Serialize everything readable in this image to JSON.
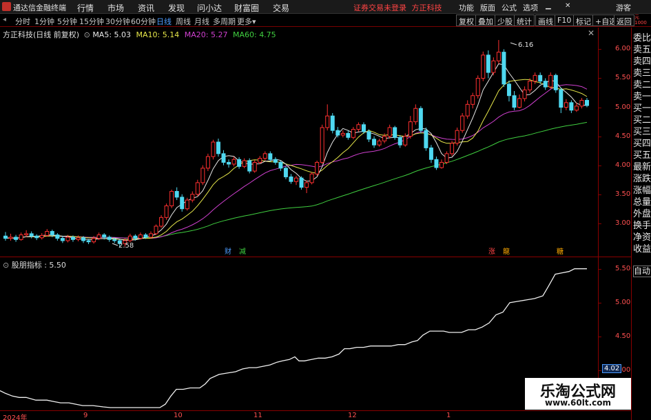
{
  "app": {
    "title": "通达信金融终端",
    "menu": [
      "行情",
      "市场",
      "资讯",
      "发现",
      "问小达",
      "财富圈",
      "交易"
    ],
    "notice": "证券交易未登录",
    "stock_name_top": "方正科技",
    "right_menu": [
      "功能",
      "版面",
      "公式",
      "选项"
    ],
    "guest": "游客"
  },
  "periods": [
    "分时",
    "1分钟",
    "5分钟",
    "15分钟",
    "30分钟",
    "60分钟",
    "日线",
    "周线",
    "月线",
    "多周期",
    "更多"
  ],
  "active_period": "日线",
  "tools": [
    "复权",
    "叠加",
    "少股",
    "统计",
    "画线",
    "F10",
    "标记",
    "+自选",
    "返回"
  ],
  "main": {
    "label": "方正科技(日线 前复权)",
    "ma": [
      {
        "name": "MA5",
        "value": "5.03",
        "color": "#e8e8e8"
      },
      {
        "name": "MA10",
        "value": "5.14",
        "color": "#e8e84a"
      },
      {
        "name": "MA20",
        "value": "5.27",
        "color": "#d040d0"
      },
      {
        "name": "MA60",
        "value": "4.75",
        "color": "#40d040"
      }
    ],
    "high_label": "6.16",
    "low_label": "2.58",
    "markers": [
      {
        "text": "财",
        "color": "#4d9cff"
      },
      {
        "text": "减",
        "color": "#40d040"
      },
      {
        "text": "涨",
        "color": "#ff4444"
      },
      {
        "text": "龍",
        "color": "#ffaa00"
      },
      {
        "text": "糖",
        "color": "#ffaa00"
      }
    ]
  },
  "side_panel": [
    "委比",
    "卖五",
    "卖四",
    "卖三",
    "卖二",
    "卖一",
    "买一",
    "买二",
    "买三",
    "买四",
    "买五",
    "最新",
    "涨跌",
    "涨幅",
    "总量",
    "外盘",
    "换手",
    "净资",
    "收益",
    "自动"
  ],
  "indicator": {
    "label": "股朋指标",
    "value": "5.50",
    "current_tag": "4.02"
  },
  "time_axis": [
    "2024年",
    "9",
    "10",
    "11",
    "12",
    "1"
  ],
  "watermark": {
    "title": "乐淘公式网",
    "url": "www.60lt.com"
  },
  "chart_data": [
    {
      "type": "candlestick",
      "title": "",
      "y_ticks": [
        6.0,
        5.5,
        5.0,
        4.5,
        4.0,
        3.5,
        3.0
      ],
      "ylim": [
        2.45,
        6.35
      ],
      "colors": {
        "up": "#ff3030",
        "down": "#4fd8f0"
      },
      "grid": false,
      "candles": [
        [
          2.78,
          2.74,
          2.85,
          2.7
        ],
        [
          2.74,
          2.76,
          2.82,
          2.7
        ],
        [
          2.76,
          2.72,
          2.8,
          2.68
        ],
        [
          2.72,
          2.8,
          2.84,
          2.7
        ],
        [
          2.8,
          2.82,
          2.88,
          2.76
        ],
        [
          2.82,
          2.78,
          2.86,
          2.74
        ],
        [
          2.78,
          2.75,
          2.81,
          2.71
        ],
        [
          2.75,
          2.79,
          2.83,
          2.72
        ],
        [
          2.79,
          2.86,
          2.9,
          2.77
        ],
        [
          2.86,
          2.8,
          2.89,
          2.76
        ],
        [
          2.8,
          2.74,
          2.83,
          2.7
        ],
        [
          2.74,
          2.7,
          2.78,
          2.66
        ],
        [
          2.7,
          2.76,
          2.8,
          2.67
        ],
        [
          2.76,
          2.72,
          2.79,
          2.68
        ],
        [
          2.72,
          2.75,
          2.79,
          2.69
        ],
        [
          2.75,
          2.7,
          2.78,
          2.66
        ],
        [
          2.7,
          2.68,
          2.73,
          2.64
        ],
        [
          2.68,
          2.74,
          2.78,
          2.65
        ],
        [
          2.74,
          2.8,
          2.84,
          2.71
        ],
        [
          2.8,
          2.76,
          2.83,
          2.72
        ],
        [
          2.76,
          2.72,
          2.79,
          2.68
        ],
        [
          2.72,
          2.7,
          2.75,
          2.66
        ],
        [
          2.7,
          2.65,
          2.72,
          2.58
        ],
        [
          2.65,
          2.7,
          2.74,
          2.6
        ],
        [
          2.7,
          2.78,
          2.82,
          2.67
        ],
        [
          2.78,
          2.74,
          2.81,
          2.7
        ],
        [
          2.74,
          2.8,
          2.84,
          2.72
        ],
        [
          2.8,
          2.76,
          2.83,
          2.73
        ],
        [
          2.76,
          2.82,
          2.86,
          2.74
        ],
        [
          2.82,
          2.95,
          2.98,
          2.8
        ],
        [
          2.95,
          3.1,
          3.14,
          2.92
        ],
        [
          3.1,
          3.3,
          3.34,
          3.06
        ],
        [
          3.3,
          3.55,
          3.58,
          3.26
        ],
        [
          3.55,
          3.45,
          3.62,
          3.4
        ],
        [
          3.45,
          3.25,
          3.5,
          3.2
        ],
        [
          3.25,
          3.4,
          3.44,
          3.22
        ],
        [
          3.4,
          3.5,
          3.55,
          3.36
        ],
        [
          3.5,
          3.7,
          3.75,
          3.46
        ],
        [
          3.7,
          3.95,
          4.0,
          3.66
        ],
        [
          3.95,
          4.15,
          4.2,
          3.9
        ],
        [
          4.15,
          4.4,
          4.44,
          4.1
        ],
        [
          4.4,
          4.2,
          4.46,
          4.15
        ],
        [
          4.2,
          4.05,
          4.26,
          4.0
        ],
        [
          4.05,
          4.02,
          4.1,
          3.96
        ],
        [
          4.02,
          4.1,
          4.15,
          3.98
        ],
        [
          4.1,
          3.98,
          4.14,
          3.94
        ],
        [
          3.98,
          4.08,
          4.12,
          3.95
        ],
        [
          4.08,
          3.9,
          4.12,
          3.86
        ],
        [
          3.9,
          4.05,
          4.09,
          3.87
        ],
        [
          4.05,
          4.12,
          4.16,
          4.02
        ],
        [
          4.12,
          4.2,
          4.24,
          4.08
        ],
        [
          4.2,
          4.1,
          4.24,
          4.06
        ],
        [
          4.1,
          4.05,
          4.14,
          4.01
        ],
        [
          4.05,
          3.95,
          4.08,
          3.9
        ],
        [
          3.95,
          3.8,
          3.98,
          3.76
        ],
        [
          3.8,
          3.72,
          3.85,
          3.68
        ],
        [
          3.72,
          3.78,
          3.82,
          3.66
        ],
        [
          3.78,
          3.62,
          3.81,
          3.58
        ],
        [
          3.62,
          3.7,
          3.74,
          3.52
        ],
        [
          3.7,
          3.85,
          3.88,
          3.67
        ],
        [
          3.85,
          4.05,
          4.08,
          3.82
        ],
        [
          4.05,
          4.65,
          4.7,
          4.02
        ],
        [
          4.65,
          4.85,
          5.05,
          4.6
        ],
        [
          4.85,
          4.6,
          4.9,
          4.55
        ],
        [
          4.6,
          4.52,
          4.66,
          4.48
        ],
        [
          4.52,
          4.55,
          4.6,
          4.48
        ],
        [
          4.55,
          4.48,
          4.6,
          4.44
        ],
        [
          4.48,
          4.62,
          4.66,
          4.45
        ],
        [
          4.62,
          4.7,
          4.74,
          4.58
        ],
        [
          4.7,
          4.58,
          4.74,
          4.54
        ],
        [
          4.58,
          4.45,
          4.62,
          4.4
        ],
        [
          4.45,
          4.35,
          4.5,
          4.3
        ],
        [
          4.35,
          4.42,
          4.46,
          4.32
        ],
        [
          4.42,
          4.5,
          4.55,
          4.38
        ],
        [
          4.5,
          4.65,
          4.7,
          4.46
        ],
        [
          4.65,
          4.48,
          4.68,
          4.44
        ],
        [
          4.48,
          4.35,
          4.52,
          4.3
        ],
        [
          4.35,
          4.5,
          4.55,
          4.32
        ],
        [
          4.5,
          4.75,
          4.85,
          4.46
        ],
        [
          4.75,
          4.98,
          5.05,
          4.7
        ],
        [
          4.98,
          4.6,
          5.02,
          4.55
        ],
        [
          4.6,
          4.3,
          4.65,
          4.25
        ],
        [
          4.3,
          4.1,
          4.35,
          4.04
        ],
        [
          4.1,
          3.96,
          4.15,
          3.92
        ],
        [
          3.96,
          4.05,
          4.1,
          3.94
        ],
        [
          4.05,
          4.2,
          4.24,
          4.02
        ],
        [
          4.2,
          4.38,
          4.42,
          4.16
        ],
        [
          4.38,
          4.6,
          4.65,
          4.34
        ],
        [
          4.6,
          4.85,
          4.9,
          4.56
        ],
        [
          4.85,
          5.05,
          5.12,
          4.8
        ],
        [
          5.05,
          5.2,
          5.25,
          4.98
        ],
        [
          5.2,
          5.5,
          5.55,
          5.15
        ],
        [
          5.5,
          5.9,
          5.96,
          5.45
        ],
        [
          5.9,
          5.6,
          5.98,
          5.5
        ],
        [
          5.6,
          5.8,
          5.86,
          5.55
        ],
        [
          5.8,
          5.95,
          6.16,
          5.75
        ],
        [
          5.95,
          5.4,
          6.0,
          5.35
        ],
        [
          5.4,
          5.2,
          5.46,
          5.1
        ],
        [
          5.2,
          5.0,
          5.28,
          4.95
        ],
        [
          5.0,
          5.15,
          5.22,
          4.98
        ],
        [
          5.15,
          5.3,
          5.36,
          5.1
        ],
        [
          5.3,
          5.45,
          5.5,
          5.25
        ],
        [
          5.45,
          5.55,
          5.6,
          5.4
        ],
        [
          5.55,
          5.45,
          5.6,
          5.4
        ],
        [
          5.45,
          5.35,
          5.5,
          5.3
        ],
        [
          5.35,
          5.55,
          5.6,
          5.32
        ],
        [
          5.55,
          5.3,
          5.58,
          5.25
        ],
        [
          5.3,
          5.0,
          5.34,
          4.9
        ],
        [
          5.0,
          5.08,
          5.14,
          4.95
        ],
        [
          5.08,
          4.95,
          5.12,
          4.9
        ],
        [
          4.95,
          5.02,
          5.08,
          4.92
        ],
        [
          5.02,
          5.12,
          5.16,
          4.98
        ],
        [
          5.12,
          5.03,
          5.16,
          5.0
        ]
      ]
    },
    {
      "type": "line",
      "title": "",
      "series_name": "股朋指标",
      "y_ticks": [
        5.5,
        5.0,
        4.5,
        4.0,
        3.5
      ],
      "ylim": [
        3.45,
        5.65
      ],
      "points": [
        [
          0,
          3.7
        ],
        [
          8,
          3.66
        ],
        [
          18,
          3.62
        ],
        [
          28,
          3.6
        ],
        [
          38,
          3.6
        ],
        [
          52,
          3.56
        ],
        [
          68,
          3.56
        ],
        [
          78,
          3.54
        ],
        [
          88,
          3.52
        ],
        [
          100,
          3.52
        ],
        [
          110,
          3.5
        ],
        [
          120,
          3.48
        ],
        [
          135,
          3.48
        ],
        [
          150,
          3.46
        ],
        [
          160,
          3.45
        ],
        [
          172,
          3.45
        ],
        [
          185,
          3.45
        ],
        [
          198,
          3.45
        ],
        [
          210,
          3.45
        ],
        [
          222,
          3.45
        ],
        [
          232,
          3.45
        ],
        [
          240,
          3.5
        ],
        [
          248,
          3.62
        ],
        [
          256,
          3.72
        ],
        [
          266,
          3.72
        ],
        [
          276,
          3.74
        ],
        [
          290,
          3.74
        ],
        [
          298,
          3.8
        ],
        [
          305,
          3.88
        ],
        [
          318,
          3.94
        ],
        [
          330,
          3.96
        ],
        [
          342,
          3.98
        ],
        [
          352,
          4.02
        ],
        [
          362,
          4.04
        ],
        [
          372,
          4.04
        ],
        [
          382,
          4.06
        ],
        [
          392,
          4.08
        ],
        [
          402,
          4.12
        ],
        [
          410,
          4.14
        ],
        [
          420,
          4.16
        ],
        [
          428,
          4.2
        ],
        [
          434,
          4.14
        ],
        [
          442,
          4.14
        ],
        [
          452,
          4.16
        ],
        [
          462,
          4.18
        ],
        [
          472,
          4.18
        ],
        [
          482,
          4.2
        ],
        [
          492,
          4.24
        ],
        [
          500,
          4.32
        ],
        [
          508,
          4.32
        ],
        [
          518,
          4.34
        ],
        [
          528,
          4.34
        ],
        [
          538,
          4.36
        ],
        [
          548,
          4.36
        ],
        [
          558,
          4.36
        ],
        [
          568,
          4.36
        ],
        [
          578,
          4.38
        ],
        [
          588,
          4.38
        ],
        [
          598,
          4.42
        ],
        [
          606,
          4.44
        ],
        [
          614,
          4.52
        ],
        [
          624,
          4.58
        ],
        [
          634,
          4.58
        ],
        [
          644,
          4.58
        ],
        [
          652,
          4.56
        ],
        [
          660,
          4.56
        ],
        [
          670,
          4.56
        ],
        [
          680,
          4.6
        ],
        [
          690,
          4.6
        ],
        [
          700,
          4.64
        ],
        [
          710,
          4.7
        ],
        [
          720,
          4.82
        ],
        [
          730,
          4.86
        ],
        [
          740,
          5.0
        ],
        [
          752,
          5.02
        ],
        [
          764,
          5.04
        ],
        [
          776,
          5.06
        ],
        [
          788,
          5.1
        ],
        [
          796,
          5.24
        ],
        [
          806,
          5.42
        ],
        [
          816,
          5.44
        ],
        [
          826,
          5.46
        ],
        [
          834,
          5.5
        ],
        [
          846,
          5.5
        ],
        [
          852,
          5.5
        ]
      ]
    }
  ]
}
